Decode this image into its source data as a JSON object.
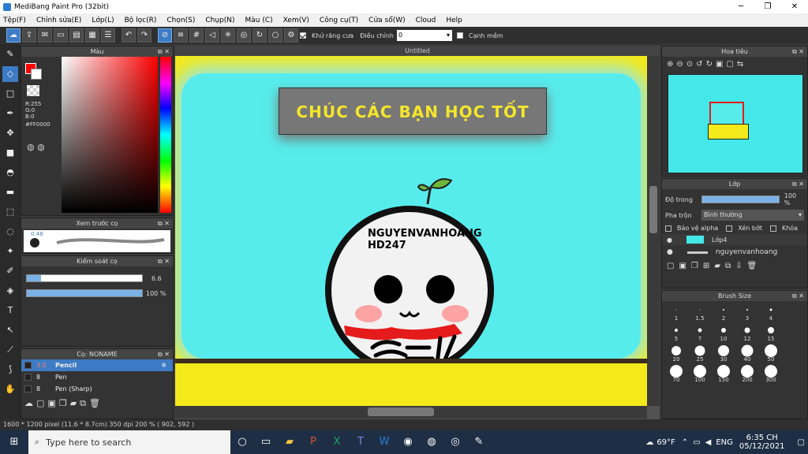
{
  "window": {
    "title": "MediBang Paint Pro (32bit)",
    "min": "─",
    "max": "❐",
    "close": "✕"
  },
  "menu": [
    "Tệp(F)",
    "Chỉnh sửa(E)",
    "Lớp(L)",
    "Bộ lọc(R)",
    "Chọn(S)",
    "Chụp(N)",
    "Màu (C)",
    "Xem(V)",
    "Công cụ(T)",
    "Cửa sổ(W)",
    "Cloud",
    "Help"
  ],
  "toolbar": {
    "antialias_label": "Khử răng cưa",
    "adjust_label": "Điều chỉnh",
    "adjust_value": "0",
    "edge_label": "Cạnh mềm"
  },
  "color_panel": {
    "title": "Màu",
    "r": "R:255",
    "g": "G:0",
    "b": "B:0",
    "hex": "#FF0000",
    "fg": "#ff0000"
  },
  "brush_preview": {
    "title": "Xem trước cọ",
    "size": "0.48"
  },
  "brush_control": {
    "title": "Kiểm soát cọ",
    "size_value": "6.6",
    "opacity_value": "100 %"
  },
  "brush_list": {
    "title": "Cọ: NONAME",
    "items": [
      {
        "size": "3.0",
        "name": "Pencil"
      },
      {
        "size": "8",
        "name": "Pen"
      },
      {
        "size": "8",
        "name": "Pen (Sharp)"
      }
    ]
  },
  "canvas": {
    "title": "Untitled",
    "banner": "CHÚC CÁC BẠN HỌC TỐT",
    "char_line1": "NGUYENVANHOANG",
    "char_line2": "HD247"
  },
  "navigator": {
    "title": "Hoa tiêu"
  },
  "layers": {
    "title": "Lớp",
    "opacity_label": "Độ trong",
    "opacity_value": "100 %",
    "blend_label": "Pha trộn",
    "blend_value": "Bình thường",
    "protect_alpha": "Bảo vệ alpha",
    "clip": "Xén bớt",
    "lock": "Khóa",
    "items": [
      {
        "name": "Lớp4"
      },
      {
        "name": "nguyenvanhoang"
      }
    ]
  },
  "brush_size": {
    "title": "Brush Size",
    "sizes": [
      "1",
      "1.5",
      "2",
      "3",
      "4",
      "5",
      "7",
      "10",
      "12",
      "15",
      "20",
      "25",
      "30",
      "40",
      "50",
      "70",
      "100",
      "150",
      "200",
      "300"
    ]
  },
  "status": {
    "text": "1600 * 1200 pixel  (11.6 * 8.7cm)  350 dpi  200 %  ( 902, 592 )"
  },
  "taskbar": {
    "search_placeholder": "Type here to search",
    "weather": "69°F",
    "lang": "ENG",
    "time": "6:35 CH",
    "date": "05/12/2021"
  }
}
